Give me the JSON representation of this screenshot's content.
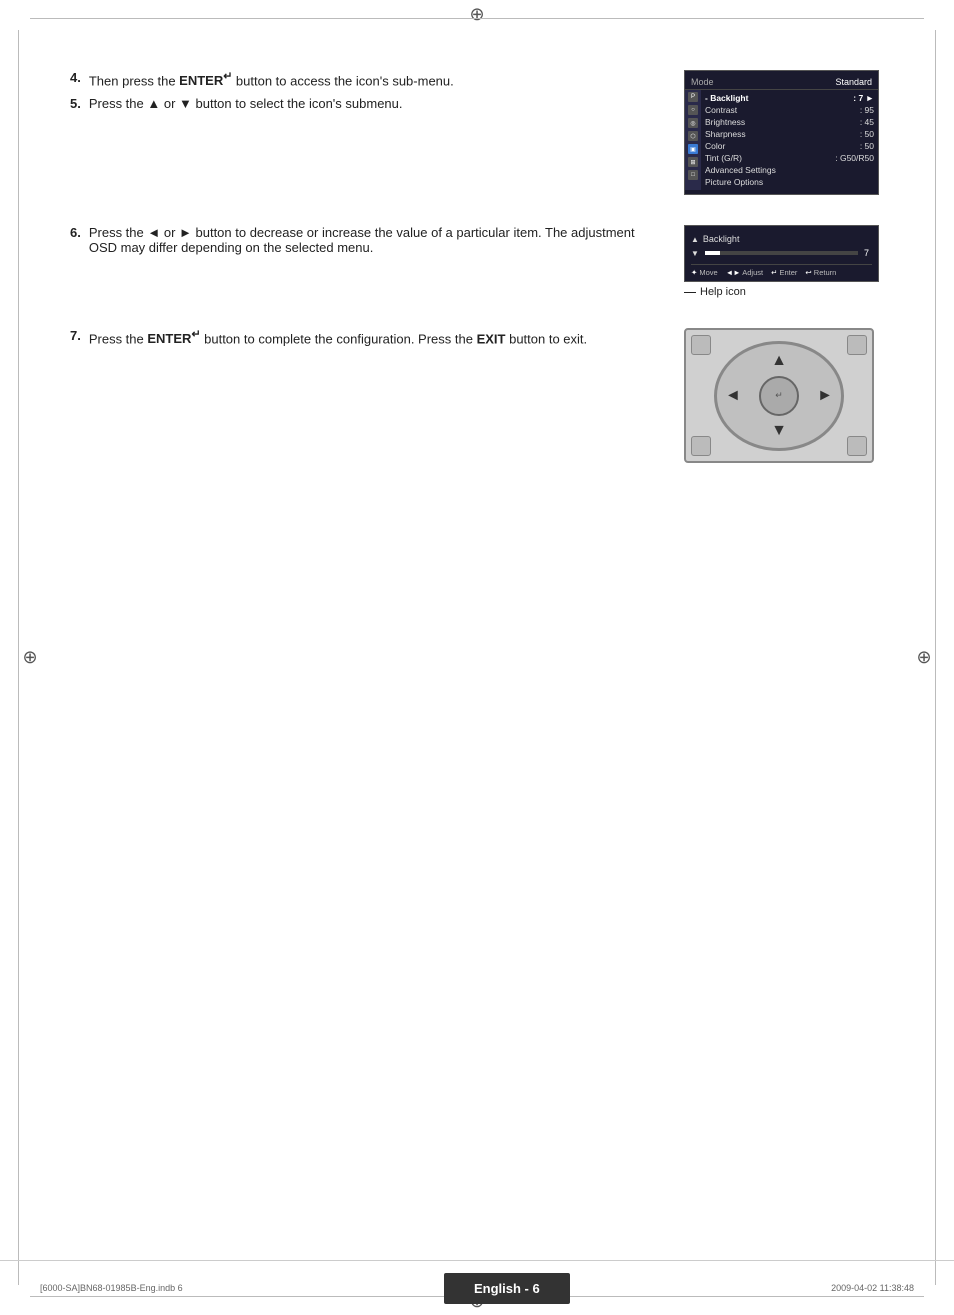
{
  "page": {
    "background": "#ffffff"
  },
  "registration_marks": {
    "symbol": "⊕"
  },
  "steps": {
    "step4": {
      "number": "4.",
      "text_before": "Then press the ",
      "enter_label": "ENTER",
      "enter_symbol": "↵",
      "text_after": " button to access the icon's sub-menu."
    },
    "step5": {
      "number": "5.",
      "text_before": "Press the ▲ or ▼ button to select the icon's submenu."
    },
    "step6": {
      "number": "6.",
      "text_before": "Press the ◄ or ► button to decrease or increase the value of a particular item. The adjustment OSD may differ depending on the selected menu."
    },
    "step7": {
      "number": "7.",
      "text_before": "Press the ",
      "enter_label": "ENTER",
      "enter_symbol": "↵",
      "text_middle": " button to complete the configuration. Press the ",
      "exit_label": "EXIT",
      "text_after": " button to exit."
    }
  },
  "osd_menu": {
    "header_label": "Mode",
    "header_value": "Standard",
    "items": [
      {
        "label": "- Backlight",
        "value": ": 7",
        "selected": true
      },
      {
        "label": "Contrast",
        "value": ": 95"
      },
      {
        "label": "Brightness",
        "value": ": 45"
      },
      {
        "label": "Sharpness",
        "value": ": 50"
      },
      {
        "label": "Color",
        "value": ": 50"
      },
      {
        "label": "Tint (G/R)",
        "value": ": G50/R50"
      },
      {
        "label": "Advanced Settings",
        "value": ""
      },
      {
        "label": "Picture Options",
        "value": ""
      }
    ]
  },
  "backlight_osd": {
    "label": "Backlight",
    "value": "7",
    "help_items": [
      {
        "icon": "✦",
        "label": "Move"
      },
      {
        "icon": "◄►",
        "label": "Adjust"
      },
      {
        "icon": "↵",
        "label": "Enter"
      },
      {
        "icon": "↩",
        "label": "Return"
      }
    ],
    "help_icon_caption": "Help icon"
  },
  "footer": {
    "left_text": "[6000-SA]BN68-01985B-Eng.indb   6",
    "center_text": "English - 6",
    "right_text": "2009-04-02     11:38:48"
  }
}
